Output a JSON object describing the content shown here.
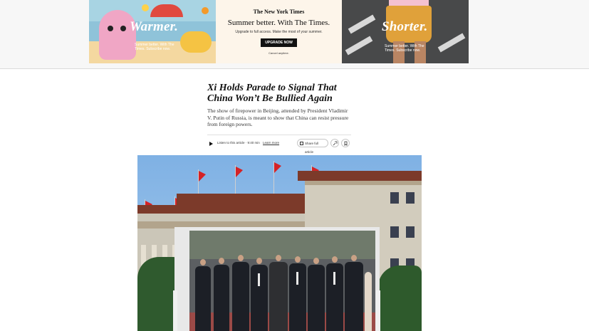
{
  "ads": {
    "left": {
      "headline": "Warmer.",
      "fine": "Summer better. With The Times. Subscribe now."
    },
    "center": {
      "logo": "The New York Times",
      "title": "Summer better. With The Times.",
      "subtitle": "Upgrade to full access. Make the most of your summer.",
      "cta": "UPGRADE NOW",
      "cancel": "Cancel anytime."
    },
    "right": {
      "headline": "Shorter.",
      "fine": "Summer better. With The Times. Subscribe now."
    }
  },
  "article": {
    "headline": "Xi Holds Parade to Signal That China Won’t Be Bullied Again",
    "summary": "The show of firepower in Beijing, attended by President Vladimir V. Putin of Russia, is meant to show that China can resist pressure from foreign powers.",
    "listen_text": "Listen to this article · 9:40 min",
    "learn_more": "Learn more",
    "share_full_label": "Share full article"
  },
  "icons": {
    "play": "play-icon",
    "gift": "gift-icon",
    "share": "share-icon",
    "bookmark": "bookmark-icon"
  },
  "colors": {
    "flag_red": "#d42226",
    "headline": "#121212"
  }
}
